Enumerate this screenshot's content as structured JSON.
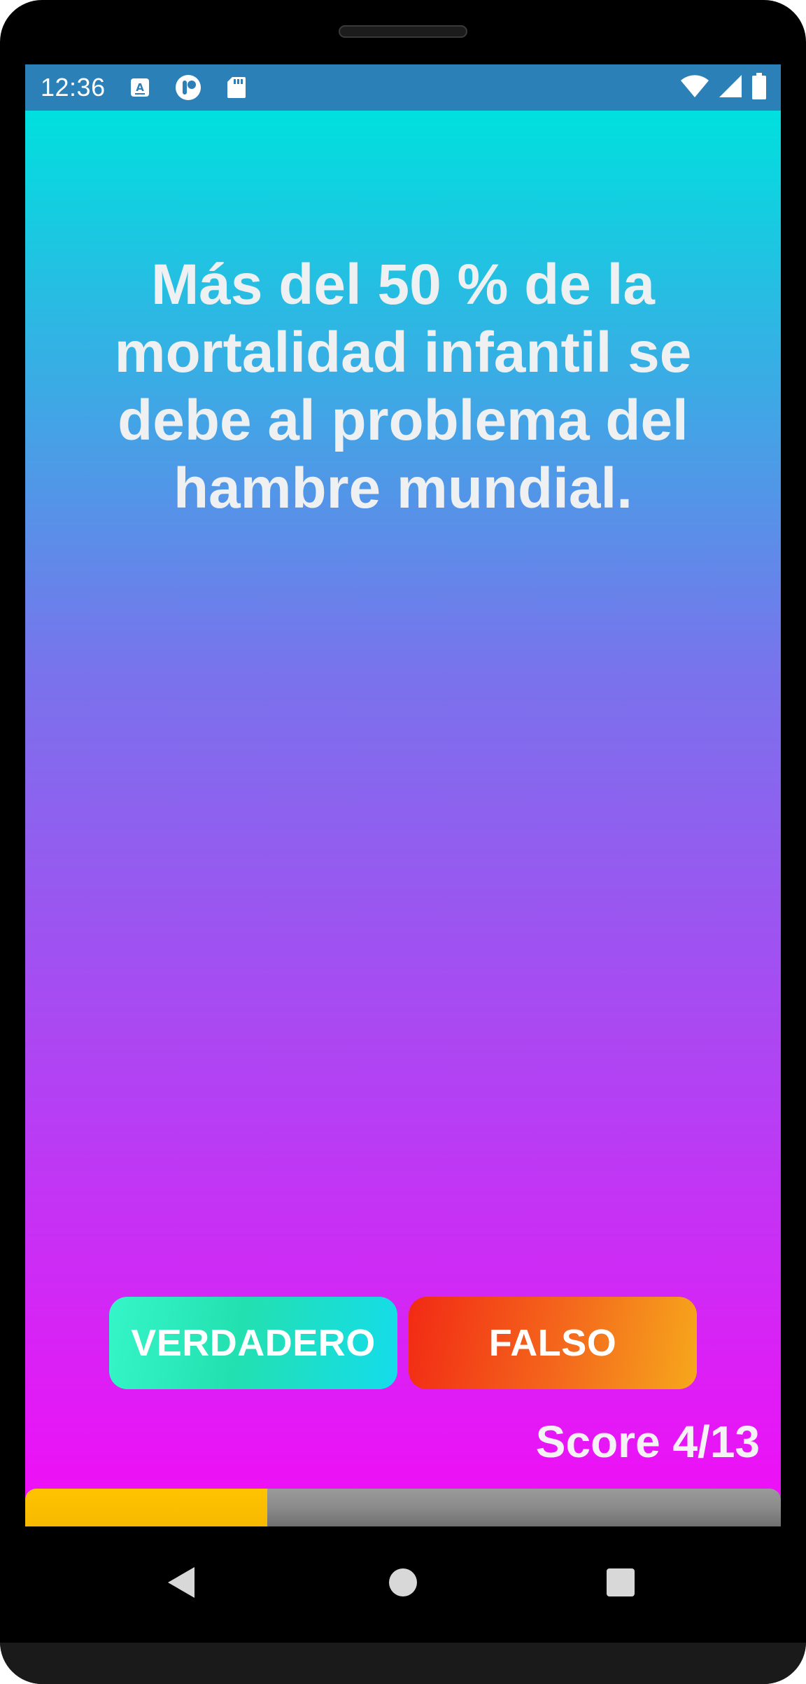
{
  "status_bar": {
    "time": "12:36",
    "left_icons": [
      "keyboard-a-icon",
      "app-notification-icon",
      "sd-card-icon"
    ],
    "right_icons": [
      "wifi-icon",
      "cellular-signal-icon",
      "battery-icon"
    ]
  },
  "question": {
    "text": "Más del 50 % de la mortalidad infantil se debe al problema del hambre mundial."
  },
  "answers": {
    "true_label": "VERDADERO",
    "false_label": "FALSO"
  },
  "score": {
    "label": "Score 4/13",
    "current": 4,
    "total": 13,
    "progress_fraction": 0.32
  },
  "navigation": {
    "icons": [
      "back-icon",
      "home-icon",
      "recents-icon"
    ]
  },
  "colors": {
    "status_bar": "#2c80b8",
    "gradient_top": "#00e0de",
    "gradient_bottom": "#f30cf6",
    "true_button": "#23e0b0",
    "false_button": "#f46a1c",
    "progress_fill": "#ffc400",
    "progress_track": "#8a8a8a"
  }
}
